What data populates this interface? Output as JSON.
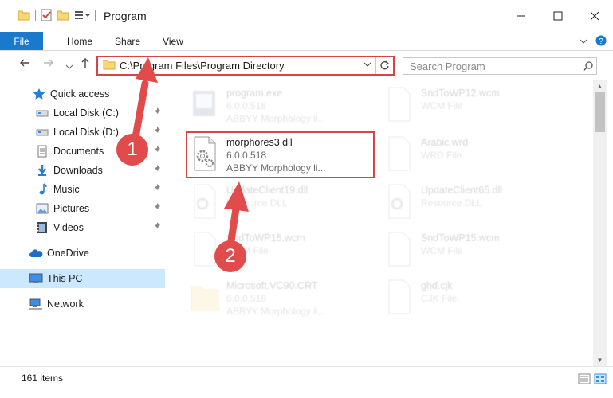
{
  "window": {
    "title": "Program"
  },
  "ribbon": {
    "tabs": [
      "File",
      "Home",
      "Share",
      "View"
    ]
  },
  "address": {
    "path": "C:\\Program Files\\Program Directory"
  },
  "search": {
    "placeholder": "Search Program"
  },
  "sidebar": {
    "items": [
      {
        "label": "Quick access",
        "icon": "star-icon"
      },
      {
        "label": "Local Disk (C:)",
        "icon": "drive-icon"
      },
      {
        "label": "Local Disk (D:)",
        "icon": "drive-icon"
      },
      {
        "label": "Documents",
        "icon": "documents-icon"
      },
      {
        "label": "Downloads",
        "icon": "download-icon"
      },
      {
        "label": "Music",
        "icon": "music-icon"
      },
      {
        "label": "Pictures",
        "icon": "pictures-icon"
      },
      {
        "label": "Videos",
        "icon": "videos-icon"
      },
      {
        "label": "OneDrive",
        "icon": "cloud-icon"
      },
      {
        "label": "This PC",
        "icon": "computer-icon"
      },
      {
        "label": "Network",
        "icon": "network-icon"
      }
    ]
  },
  "files": [
    {
      "name": "program.exe",
      "line2": "6.0.0.518",
      "line3": "ABBYY Morphology li..."
    },
    {
      "name": "SndToWP12.wcm",
      "line2": "WCM File",
      "line3": ""
    },
    {
      "name": "morphores3.dll",
      "line2": "6.0.0.518",
      "line3": "ABBYY Morphology li..."
    },
    {
      "name": "Arabic.wrd",
      "line2": "WRD File",
      "line3": ""
    },
    {
      "name": "UpdateClient19.dll",
      "line2": "Resource DLL",
      "line3": ""
    },
    {
      "name": "UpdateClient65.dll",
      "line2": "Resource DLL",
      "line3": ""
    },
    {
      "name": "SndToWP15.wcm",
      "line2": "WCM File",
      "line3": ""
    },
    {
      "name": "SndToWP15.wcm",
      "line2": "WCM File",
      "line3": ""
    },
    {
      "name": "Microsoft.VC90.CRT",
      "line2": "6.0.0.518",
      "line3": "ABBYY Morphology li..."
    },
    {
      "name": "ghd.cjk",
      "line2": "CJK File",
      "line3": ""
    }
  ],
  "status": {
    "count": "161 items"
  },
  "annotations": {
    "step1": "1",
    "step2": "2",
    "color": "#e24b4b"
  },
  "colors": {
    "accent": "#1979ca",
    "selection": "#cce8ff",
    "highlight": "#d64545"
  }
}
